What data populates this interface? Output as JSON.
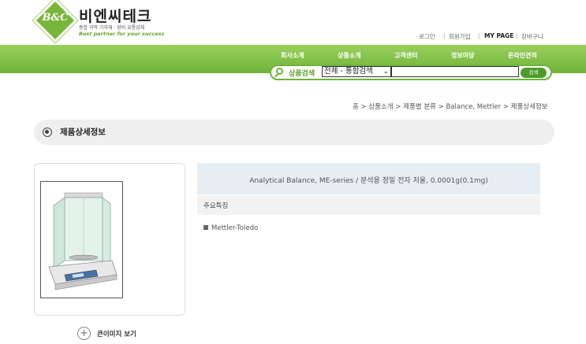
{
  "header": {
    "logo_text": "B&C",
    "brand_name": "비엔씨테크",
    "brand_subtitle": "종합 과학 기자재 · 장비 유통업체",
    "brand_tagline": "Best partner for your success",
    "util_links": [
      "로그인",
      "회원가입",
      "MY PAGE",
      "장바구니"
    ]
  },
  "nav": {
    "items": [
      "회사소개",
      "상품소개",
      "고객센터",
      "정보마당",
      "온라인견적"
    ]
  },
  "search": {
    "label": "상품검색",
    "select_value": "전체 - 통합검색",
    "input_value": "",
    "button_label": "검색"
  },
  "breadcrumb": "홈 > 상품소개 > 제품별 분류 > Balance, Mettler > 제품상세정보",
  "section_title": "제품상세정보",
  "product": {
    "title": "Analytical Balance, ME-series / 분석용 정밀 전자 저울, 0.0001g(0.1mg)",
    "features_label": "주요특징",
    "features": [
      "Mettler-Toledo"
    ],
    "zoom_label": "큰이미지 보기"
  },
  "colors": {
    "nav_green": "#7cbd44",
    "accent_green": "#6fb33a",
    "info_header_bg": "#e6edf3"
  }
}
